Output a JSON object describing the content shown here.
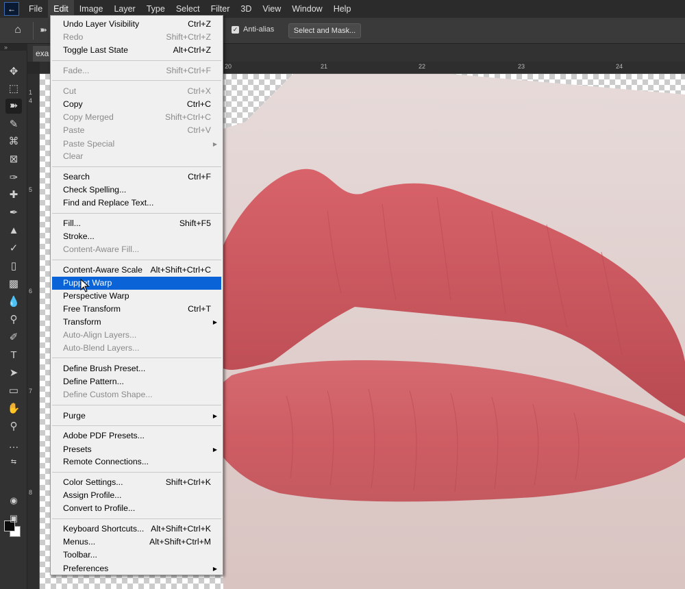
{
  "app": {
    "logo_text": "Ps",
    "open_document_tab": "exa"
  },
  "menubar": [
    {
      "label": "File"
    },
    {
      "label": "Edit"
    },
    {
      "label": "Image"
    },
    {
      "label": "Layer"
    },
    {
      "label": "Type"
    },
    {
      "label": "Select"
    },
    {
      "label": "Filter"
    },
    {
      "label": "3D"
    },
    {
      "label": "View"
    },
    {
      "label": "Window"
    },
    {
      "label": "Help"
    }
  ],
  "options": {
    "antialias_label": "Anti-alias",
    "antialias_checked": true,
    "select_mask_label": "Select and Mask..."
  },
  "rulers": {
    "top": [
      "20",
      "21",
      "22",
      "23",
      "24"
    ],
    "left": [
      "1",
      "4",
      "5",
      "6",
      "7",
      "8"
    ]
  },
  "edit_menu": {
    "items": [
      {
        "label": "Undo Layer Visibility",
        "shortcut": "Ctrl+Z",
        "disabled": false
      },
      {
        "label": "Redo",
        "shortcut": "Shift+Ctrl+Z",
        "disabled": true
      },
      {
        "label": "Toggle Last State",
        "shortcut": "Alt+Ctrl+Z",
        "disabled": false
      },
      {
        "label": "Fade...",
        "shortcut": "Shift+Ctrl+F",
        "disabled": true
      },
      {
        "label": "Cut",
        "shortcut": "Ctrl+X",
        "disabled": true
      },
      {
        "label": "Copy",
        "shortcut": "Ctrl+C",
        "disabled": false
      },
      {
        "label": "Copy Merged",
        "shortcut": "Shift+Ctrl+C",
        "disabled": true
      },
      {
        "label": "Paste",
        "shortcut": "Ctrl+V",
        "disabled": true
      },
      {
        "label": "Paste Special",
        "shortcut": "",
        "disabled": true,
        "submenu": true
      },
      {
        "label": "Clear",
        "shortcut": "",
        "disabled": true
      },
      {
        "label": "Search",
        "shortcut": "Ctrl+F",
        "disabled": false
      },
      {
        "label": "Check Spelling...",
        "shortcut": "",
        "disabled": false
      },
      {
        "label": "Find and Replace Text...",
        "shortcut": "",
        "disabled": false
      },
      {
        "label": "Fill...",
        "shortcut": "Shift+F5",
        "disabled": false
      },
      {
        "label": "Stroke...",
        "shortcut": "",
        "disabled": false
      },
      {
        "label": "Content-Aware Fill...",
        "shortcut": "",
        "disabled": true
      },
      {
        "label": "Content-Aware Scale",
        "shortcut": "Alt+Shift+Ctrl+C",
        "disabled": false
      },
      {
        "label": "Puppet Warp",
        "shortcut": "",
        "disabled": false,
        "highlighted": true
      },
      {
        "label": "Perspective Warp",
        "shortcut": "",
        "disabled": false
      },
      {
        "label": "Free Transform",
        "shortcut": "Ctrl+T",
        "disabled": false
      },
      {
        "label": "Transform",
        "shortcut": "",
        "disabled": false,
        "submenu": true
      },
      {
        "label": "Auto-Align Layers...",
        "shortcut": "",
        "disabled": true
      },
      {
        "label": "Auto-Blend Layers...",
        "shortcut": "",
        "disabled": true
      },
      {
        "label": "Define Brush Preset...",
        "shortcut": "",
        "disabled": false
      },
      {
        "label": "Define Pattern...",
        "shortcut": "",
        "disabled": false
      },
      {
        "label": "Define Custom Shape...",
        "shortcut": "",
        "disabled": true
      },
      {
        "label": "Purge",
        "shortcut": "",
        "disabled": false,
        "submenu": true
      },
      {
        "label": "Adobe PDF Presets...",
        "shortcut": "",
        "disabled": false
      },
      {
        "label": "Presets",
        "shortcut": "",
        "disabled": false,
        "submenu": true
      },
      {
        "label": "Remote Connections...",
        "shortcut": "",
        "disabled": false
      },
      {
        "label": "Color Settings...",
        "shortcut": "Shift+Ctrl+K",
        "disabled": false
      },
      {
        "label": "Assign Profile...",
        "shortcut": "",
        "disabled": false
      },
      {
        "label": "Convert to Profile...",
        "shortcut": "",
        "disabled": false
      },
      {
        "label": "Keyboard Shortcuts...",
        "shortcut": "Alt+Shift+Ctrl+K",
        "disabled": false
      },
      {
        "label": "Menus...",
        "shortcut": "Alt+Shift+Ctrl+M",
        "disabled": false
      },
      {
        "label": "Toolbar...",
        "shortcut": "",
        "disabled": false
      },
      {
        "label": "Preferences",
        "shortcut": "",
        "disabled": false,
        "submenu": true
      }
    ]
  },
  "colors": {
    "highlight": "#0a64d8",
    "menu_bg": "#f0f0f0",
    "app_bg": "#282828",
    "lip": "#cf5a61",
    "skin": "#e4d3d0"
  }
}
